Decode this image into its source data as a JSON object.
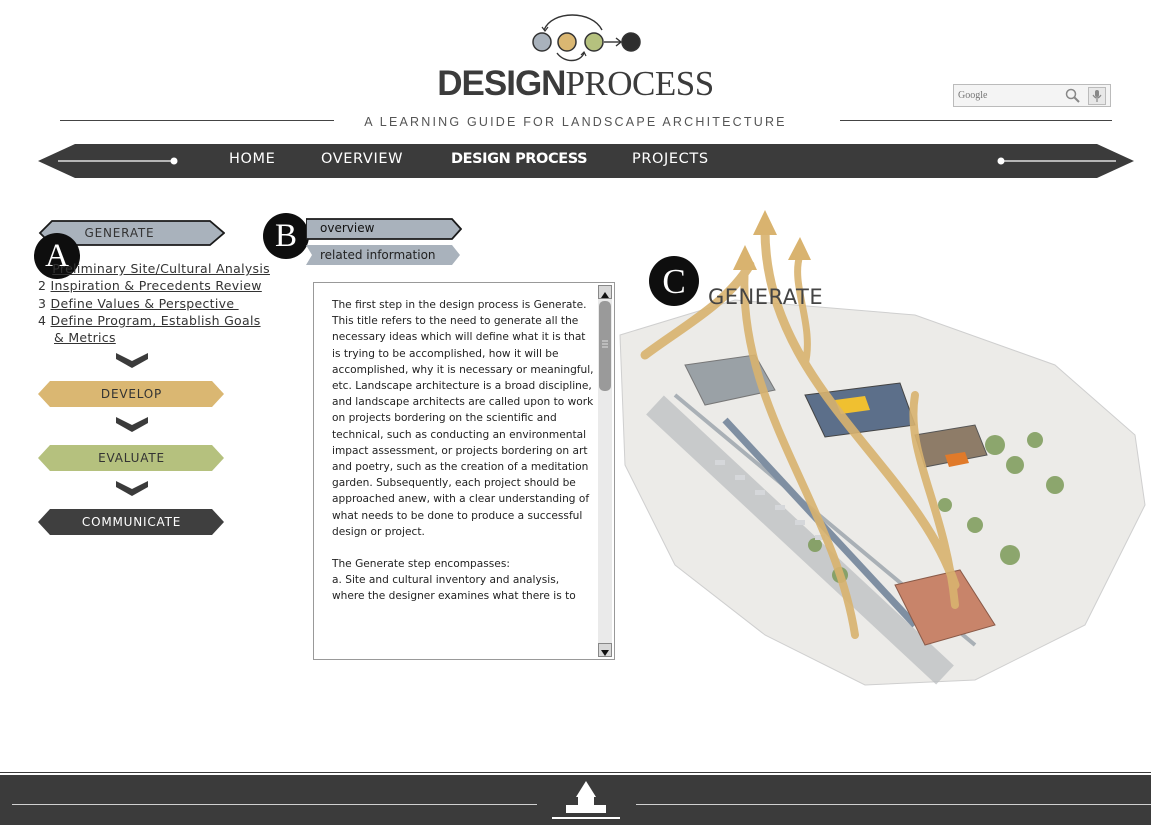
{
  "header": {
    "title_bold": "DESIGN",
    "title_regular": "PROCESS",
    "tagline": "A LEARNING GUIDE FOR LANDSCAPE ARCHITECTURE",
    "search_placeholder": "Google"
  },
  "nav": {
    "items": [
      {
        "label": "HOME"
      },
      {
        "label": "OVERVIEW"
      },
      {
        "label": "DESIGN PROCESS"
      },
      {
        "label": "PROJECTS"
      }
    ],
    "active": "DESIGN PROCESS"
  },
  "steps": [
    {
      "label": "GENERATE",
      "color": "#a9b2bc"
    },
    {
      "label": "DEVELOP",
      "color": "#dab772"
    },
    {
      "label": "EVALUATE",
      "color": "#b5c17e"
    },
    {
      "label": "COMMUNICATE",
      "color": "#3f3f3f"
    }
  ],
  "generate_subitems": [
    {
      "num": "1",
      "label": "Preliminary Site/Cultural Analysis"
    },
    {
      "num": "2",
      "label": "Inspiration & Precedents Review"
    },
    {
      "num": "3",
      "label": "Define Values & Perspective "
    },
    {
      "num": "4",
      "label": "Define Program, Establish Goals",
      "label2": "& Metrics"
    }
  ],
  "badges": {
    "a": "A",
    "b": "B",
    "c": "C"
  },
  "tabs": [
    {
      "label": "overview"
    },
    {
      "label": "related information"
    }
  ],
  "panel": {
    "paragraph1": "The first step in the design process is Generate. This title refers to the need to generate all the necessary ideas which will define what it is that is trying to be accomplished, how it will be accomplished, why it is necessary or meaningful, etc. Landscape architecture is a broad discipline, and landscape architects are called upon to work on projects bordering on the scientific and technical, such as conducting an environmental impact assessment, or projects bordering on art and poetry, such as the creation of a meditation garden. Subsequently, each project should be approached anew, with a clear understanding of what needs to be done to produce a successful design or project.",
    "paragraph2_line1": "The Generate step encompasses:",
    "paragraph2_line2": "a. Site and cultural inventory and analysis, where the designer examines what there is to"
  },
  "illustration": {
    "heading": "GENERATE"
  },
  "colors": {
    "nav_bg": "#3b3b3b",
    "generate": "#a9b2bc",
    "develop": "#dab772",
    "evaluate": "#b5c17e",
    "communicate": "#3f3f3f",
    "arrow_gold": "#d9b36f"
  }
}
